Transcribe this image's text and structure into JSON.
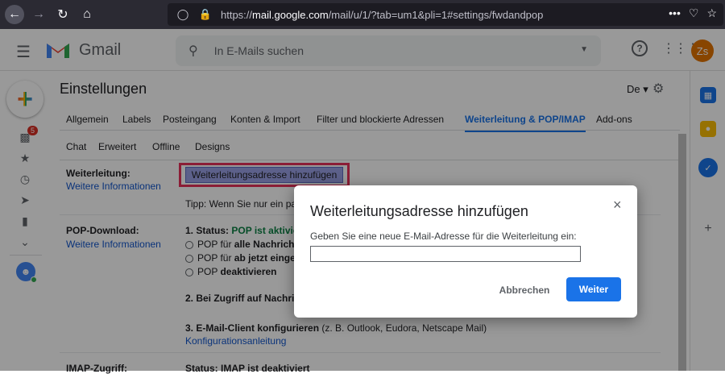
{
  "browser": {
    "url_prefix": "https://",
    "url_domain": "mail.google.com",
    "url_path": "/mail/u/1/?tab=um1&pli=1#settings/fwdandpop",
    "more": "•••"
  },
  "header": {
    "brand": "Gmail",
    "search_placeholder": "In E-Mails suchen",
    "avatar_initials": "Zs",
    "help": "?"
  },
  "rail": {
    "inbox_badge": "5"
  },
  "settings": {
    "title": "Einstellungen",
    "lang": "De",
    "tabs": [
      "Allgemein",
      "Labels",
      "Posteingang",
      "Konten & Import",
      "Filter und blockierte Adressen",
      "Weiterleitung & POP/IMAP",
      "Add-ons",
      "Chat",
      "Erweitert",
      "Offline",
      "Designs"
    ],
    "forward": {
      "label": "Weiterleitung:",
      "more_info": "Weitere Informationen",
      "button": "Weiterleitungsadresse hinzufügen",
      "tip": "Tipp: Wenn Sie nur ein pa"
    },
    "pop": {
      "label": "POP-Download:",
      "more_info": "Weitere Informationen",
      "status_prefix": "1. Status: ",
      "status_value": "POP ist aktivie",
      "opt1_prefix": "POP für ",
      "opt1_bold": "alle Nachricht",
      "opt2_prefix": "POP für ",
      "opt2_bold": "ab jetzt einge",
      "opt3_prefix": "POP ",
      "opt3_bold": "deaktivieren",
      "step2": "2. Bei Zugriff auf Nachric",
      "step3_bold": "3. E-Mail-Client konfigurieren",
      "step3_rest": " (z. B. Outlook, Eudora, Netscape Mail)",
      "config_link": "Konfigurationsanleitung"
    },
    "imap": {
      "label": "IMAP-Zugriff:",
      "status": "Status: IMAP ist deaktiviert"
    }
  },
  "dialog": {
    "title": "Weiterleitungsadresse hinzufügen",
    "label": "Geben Sie eine neue E-Mail-Adresse für die Weiterleitung ein:",
    "input_value": "",
    "cancel": "Abbrechen",
    "ok": "Weiter",
    "close": "×"
  }
}
